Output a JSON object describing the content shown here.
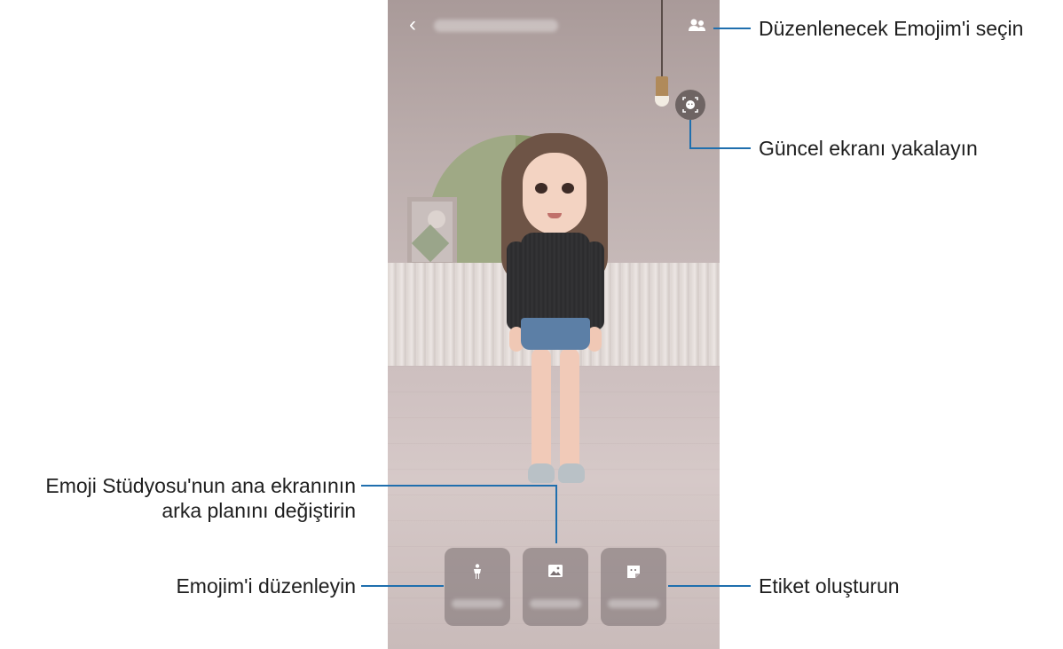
{
  "callouts": {
    "select_emoji": "Düzenlenecek Emojim'i seçin",
    "capture_screen": "Güncel ekranı yakalayın",
    "change_background_line1": "Emoji Stüdyosu'nun ana ekranının",
    "change_background_line2": "arka planını değiştirin",
    "edit_emoji": "Emojim'i düzenleyin",
    "create_sticker": "Etiket oluşturun"
  },
  "icons": {
    "back": "chevron-left-icon",
    "select_emoji": "people-icon",
    "capture": "capture-face-icon",
    "edit_emoji": "person-icon",
    "background": "image-icon",
    "sticker": "sticker-icon"
  },
  "colors": {
    "callout_line": "#1f6fae",
    "text": "#1e1e1e"
  }
}
